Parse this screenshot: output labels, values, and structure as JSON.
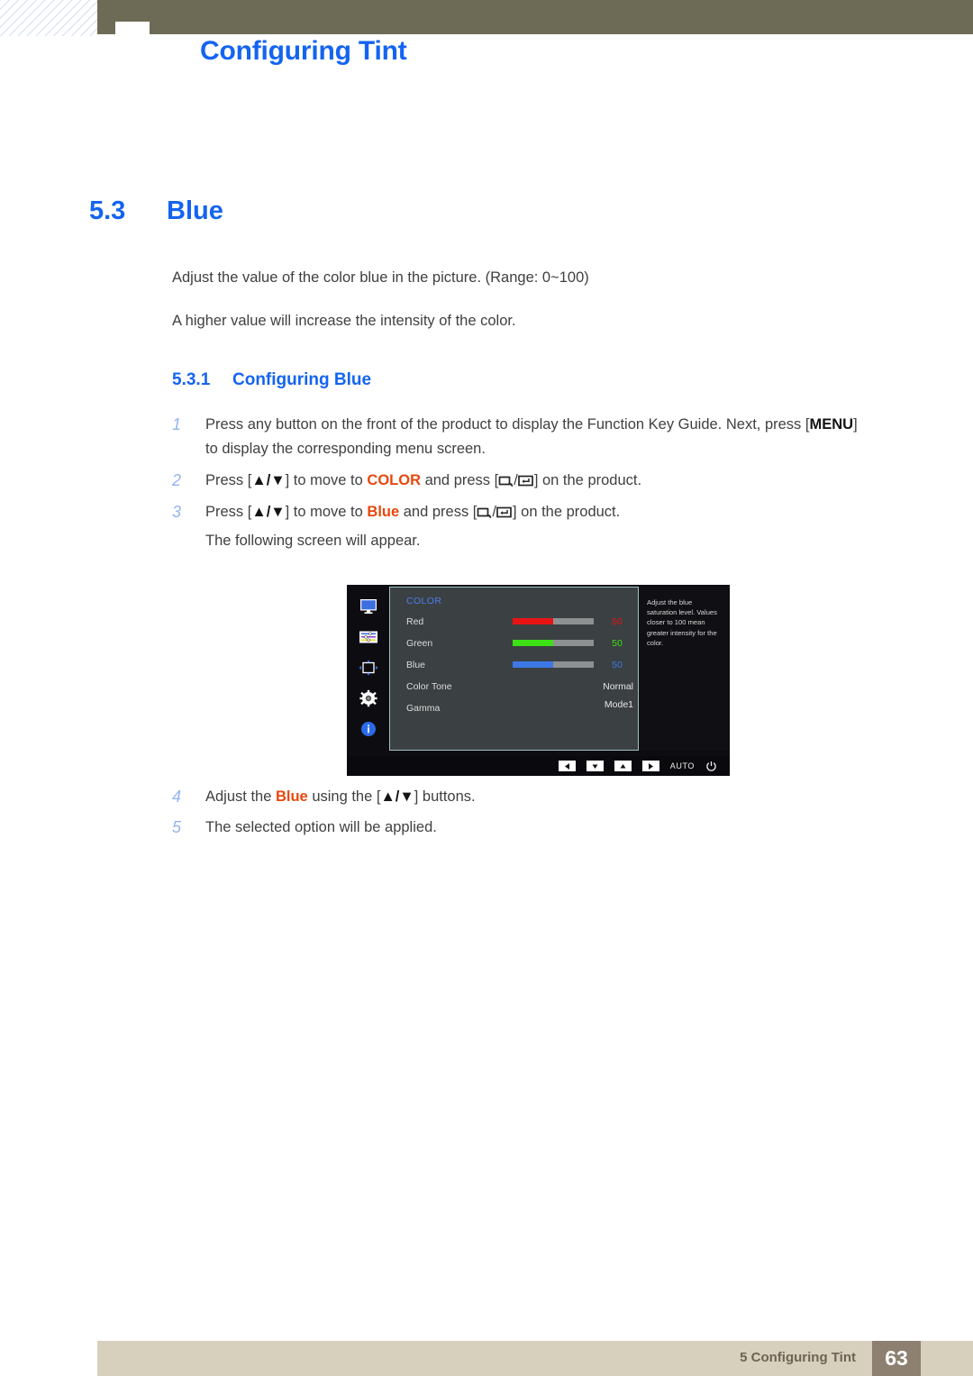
{
  "header": {
    "title": "Configuring Tint"
  },
  "section": {
    "number": "5.3",
    "title": "Blue"
  },
  "paragraphs": {
    "p1": "Adjust the value of the color blue in the picture. (Range: 0~100)",
    "p2": "A higher value will increase the intensity of the color."
  },
  "subsection": {
    "number": "5.3.1",
    "title": "Configuring Blue"
  },
  "steps": {
    "one": {
      "no": "1",
      "pre": "Press any button on the front of the product to display the Function Key Guide. Next, press [",
      "key": "MENU",
      "post": "]",
      "cont": "to display the corresponding menu screen."
    },
    "two": {
      "no": "2",
      "a": "Press [",
      "arrows": "▲/▼",
      "b": "] to move to ",
      "target": "COLOR",
      "c": " and press [",
      "d": "] on the product."
    },
    "three": {
      "no": "3",
      "a": "Press [",
      "arrows": "▲/▼",
      "b": "] to move to ",
      "target": "Blue",
      "c": " and press [",
      "d": "] on the product.",
      "cont": "The following screen will appear."
    },
    "four": {
      "no": "4",
      "a": "Adjust the ",
      "target": "Blue",
      "b": " using the [",
      "arrows": "▲/▼",
      "c": "] buttons."
    },
    "five": {
      "no": "5",
      "text": "The selected option will be applied."
    }
  },
  "osd": {
    "menu_title": "COLOR",
    "sidebar_icons": [
      "display-icon",
      "picture-sliders-icon",
      "screen-adjust-icon",
      "setup-gear-icon",
      "information-icon"
    ],
    "rows": [
      {
        "label": "Red",
        "value": "50",
        "kind": "bar",
        "fill_pct": 50,
        "color": "#e81414"
      },
      {
        "label": "Green",
        "value": "50",
        "kind": "bar",
        "fill_pct": 50,
        "color": "#3ce014"
      },
      {
        "label": "Blue",
        "value": "50",
        "kind": "bar",
        "fill_pct": 50,
        "color": "#3c78e6"
      },
      {
        "label": "Color Tone",
        "value": "Normal",
        "kind": "text",
        "fill_pct": 0,
        "color": "#e6e6e6"
      },
      {
        "label": "Gamma",
        "value": "Mode1",
        "kind": "text",
        "fill_pct": 0,
        "color": "#e6e6e6"
      }
    ],
    "tooltip": "Adjust the blue saturation level. Values closer to 100 mean greater intensity for the color.",
    "function_keys": [
      "left-arrow-key",
      "down-arrow-key",
      "up-arrow-key",
      "right-arrow-key"
    ],
    "auto_label": "AUTO",
    "power_icon": "power-icon"
  },
  "footer": {
    "text": "5 Configuring Tint",
    "page": "63"
  },
  "colors": {
    "accent_blue": "#1464f0",
    "highlight_orange": "#e8480c",
    "header_olive": "#6d6b55",
    "footer_beige": "#d6d0bd",
    "page_box_brown": "#8d8071"
  }
}
